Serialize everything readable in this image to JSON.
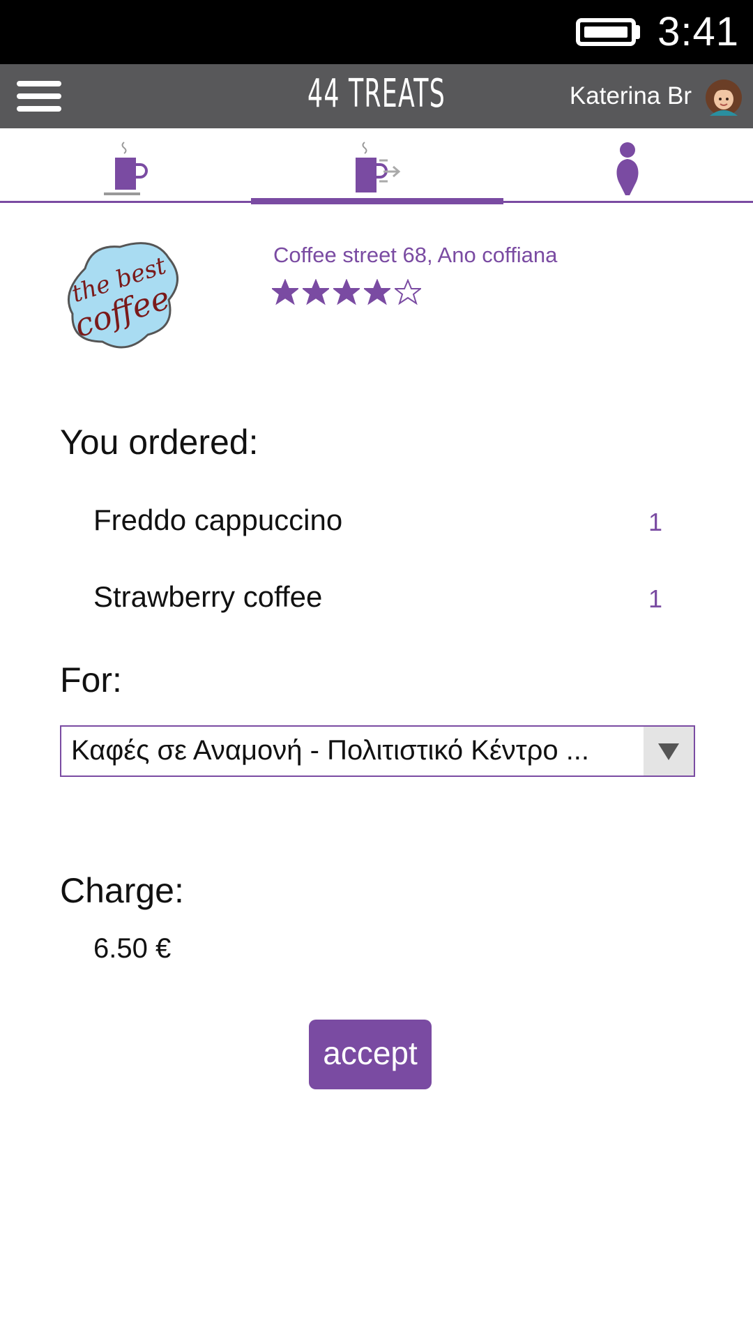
{
  "status_bar": {
    "time": "3:41",
    "battery_icon": "battery-icon"
  },
  "app_bar": {
    "menu_icon": "hamburger-menu-icon",
    "brand": "44 TREATS",
    "user_name": "Katerina Br",
    "avatar_icon": "user-avatar"
  },
  "tabs": [
    {
      "icon": "coffee-cup-icon",
      "active": false
    },
    {
      "icon": "coffee-send-icon",
      "active": true
    },
    {
      "icon": "person-icon",
      "active": false
    }
  ],
  "shop": {
    "logo_line1": "the best",
    "logo_line2": "coffee",
    "address": "Coffee street 68, Ano coffiana",
    "rating": 4,
    "rating_max": 5
  },
  "order": {
    "title": "You ordered:",
    "items": [
      {
        "name": "Freddo cappuccino",
        "qty": "1"
      },
      {
        "name": "Strawberry coffee",
        "qty": "1"
      }
    ]
  },
  "for": {
    "title": "For:",
    "selected": "Καφές σε Αναμονή - Πολιτιστικό Κέντρο ..."
  },
  "charge": {
    "title": "Charge:",
    "value": "6.50 €"
  },
  "actions": {
    "accept_label": "accept"
  },
  "colors": {
    "accent": "#7a4ba2",
    "app_bar": "#58585a",
    "status_bar": "#000000"
  }
}
